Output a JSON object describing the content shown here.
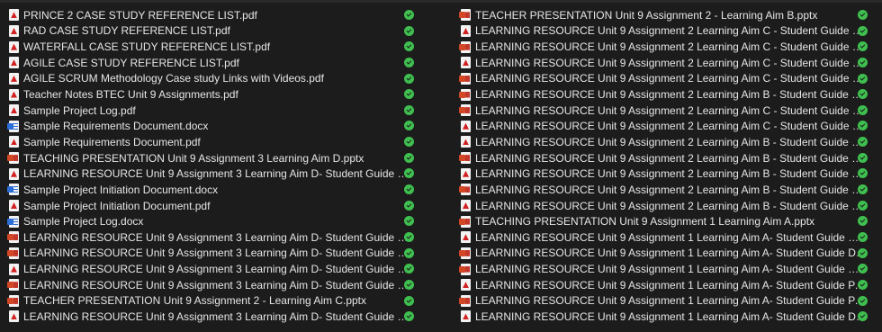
{
  "left_files": [
    {
      "name": "PRINCE 2 CASE STUDY REFERENCE LIST.pdf",
      "type": "pdf"
    },
    {
      "name": "RAD CASE STUDY REFERENCE LIST.pdf",
      "type": "pdf"
    },
    {
      "name": "WATERFALL CASE STUDY REFERENCE LIST.pdf",
      "type": "pdf"
    },
    {
      "name": "AGILE CASE STUDY REFERENCE LIST.pdf",
      "type": "pdf"
    },
    {
      "name": "AGILE SCRUM Methodology Case study Links with Videos.pdf",
      "type": "pdf"
    },
    {
      "name": "Teacher Notes BTEC Unit 9 Assignments.pdf",
      "type": "pdf"
    },
    {
      "name": "Sample Project Log.pdf",
      "type": "pdf"
    },
    {
      "name": "Sample Requirements Document.docx",
      "type": "docx"
    },
    {
      "name": "Sample Requirements Document.pdf",
      "type": "pdf"
    },
    {
      "name": "TEACHING PRESENTATION Unit 9 Assignment 3 Learning Aim D.pptx",
      "type": "pptx"
    },
    {
      "name": "LEARNING RESOURCE Unit 9 Assignment 3 Learning Aim D- Student Guide Merit.pdf",
      "type": "pdf"
    },
    {
      "name": "Sample Project Initiation Document.docx",
      "type": "docx"
    },
    {
      "name": "Sample Project Initiation Document.pdf",
      "type": "pdf"
    },
    {
      "name": "Sample Project Log.docx",
      "type": "docx"
    },
    {
      "name": "LEARNING RESOURCE Unit 9 Assignment 3 Learning Aim D- Student Guide Distinction.pptx",
      "type": "pptx"
    },
    {
      "name": "LEARNING RESOURCE Unit 9 Assignment 3 Learning Aim D- Student Guide Merit.pptx",
      "type": "pptx"
    },
    {
      "name": "LEARNING RESOURCE Unit 9 Assignment 3 Learning Aim D- Student Guide Pass.pdf",
      "type": "pdf"
    },
    {
      "name": "LEARNING RESOURCE Unit 9 Assignment 3 Learning Aim D- Student Guide Pass.pptx",
      "type": "pptx"
    },
    {
      "name": "TEACHER PRESENTATION Unit 9 Assignment 2 - Learning Aim C.pptx",
      "type": "pptx"
    },
    {
      "name": "LEARNING RESOURCE Unit 9 Assignment 3 Learning Aim D- Student Guide Distinction.pdf",
      "type": "pdf"
    }
  ],
  "right_files": [
    {
      "name": "TEACHER PRESENTATION Unit 9 Assignment 2 - Learning Aim B.pptx",
      "type": "pptx"
    },
    {
      "name": "LEARNING RESOURCE Unit 9 Assignment 2 Learning Aim C - Student Guide Distinction.pdf",
      "type": "pdf"
    },
    {
      "name": "LEARNING RESOURCE Unit 9 Assignment 2 Learning Aim C - Student Guide Merit.pptx",
      "type": "pptx"
    },
    {
      "name": "LEARNING RESOURCE Unit 9 Assignment 2 Learning Aim C - Student Guide Pass.pdf",
      "type": "pdf"
    },
    {
      "name": "LEARNING RESOURCE Unit 9 Assignment 2 Learning Aim C - Student Guide Pass.pptx",
      "type": "pptx"
    },
    {
      "name": "LEARNING RESOURCE Unit 9 Assignment 2 Learning Aim B - Student Guide Pass.pptx",
      "type": "pptx"
    },
    {
      "name": "LEARNING RESOURCE Unit 9 Assignment 2 Learning Aim C - Student Guide Distinction.pptx",
      "type": "pptx"
    },
    {
      "name": "LEARNING RESOURCE Unit 9 Assignment 2 Learning Aim C - Student Guide Merit.pdf",
      "type": "pdf"
    },
    {
      "name": "LEARNING RESOURCE Unit 9 Assignment 2 Learning Aim B - Student Guide Distinction.pdf",
      "type": "pdf"
    },
    {
      "name": "LEARNING RESOURCE Unit 9 Assignment 2 Learning Aim B - Student Guide Distinction.pptx",
      "type": "pptx"
    },
    {
      "name": "LEARNING RESOURCE Unit 9 Assignment 2 Learning Aim B - Student Guide Merit.pdf",
      "type": "pdf"
    },
    {
      "name": "LEARNING RESOURCE Unit 9 Assignment 2 Learning Aim B - Student Guide Merit.pptx",
      "type": "pptx"
    },
    {
      "name": "LEARNING RESOURCE Unit 9 Assignment 2 Learning Aim B - Student Guide Pass.pdf",
      "type": "pdf"
    },
    {
      "name": "TEACHING PRESENTATION Unit 9 Assignment 1 Learning Aim A.pptx",
      "type": "pptx"
    },
    {
      "name": "LEARNING RESOURCE Unit 9 Assignment 1 Learning Aim A- Student Guide MERIT.pdf",
      "type": "pdf"
    },
    {
      "name": "LEARNING RESOURCE Unit 9 Assignment 1 Learning Aim A- Student Guide Distinction.pptx",
      "type": "pptx"
    },
    {
      "name": "LEARNING RESOURCE Unit 9 Assignment 1 Learning Aim A- Student Guide MERIT.pptx",
      "type": "pptx"
    },
    {
      "name": "LEARNING RESOURCE Unit 9 Assignment 1 Learning Aim A- Student Guide PASS.pdf",
      "type": "pdf"
    },
    {
      "name": "LEARNING RESOURCE Unit 9 Assignment 1 Learning Aim A- Student Guide PASS.pptx",
      "type": "pptx"
    },
    {
      "name": "LEARNING RESOURCE Unit 9 Assignment 1 Learning Aim A- Student Guide Distinction.pdf",
      "type": "pdf"
    }
  ],
  "status": {
    "icon": "synced-check-icon",
    "color": "#3fbf4f"
  }
}
